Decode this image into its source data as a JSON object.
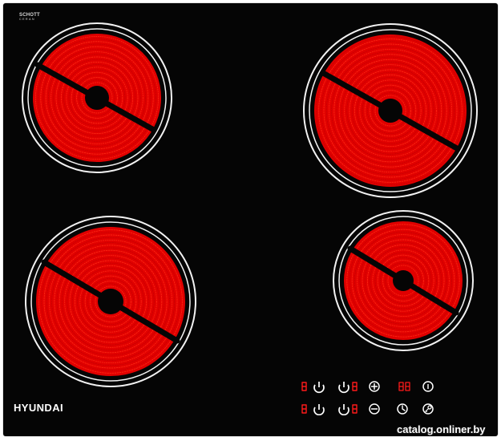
{
  "brand": {
    "name": "HYUNDAI"
  },
  "glass_logo": {
    "main": "SCHOTT",
    "sub": "CERAN"
  },
  "watermark": {
    "text": "catalog.onliner.by"
  },
  "colors": {
    "glass": "#050505",
    "coil": "#e00000",
    "coil_highlight": "#ff2a14",
    "ring": "#f2f2f2",
    "control_red": "#ff1a1a",
    "control_white": "#ffffff"
  },
  "cooking_zones": [
    {
      "name": "rear-left-zone"
    },
    {
      "name": "rear-right-zone"
    },
    {
      "name": "front-left-zone"
    },
    {
      "name": "front-right-zone"
    }
  ],
  "controls": [
    {
      "name": "rear-left-power-button",
      "icon": "power-icon"
    },
    {
      "name": "rear-right-power-button",
      "icon": "power-icon"
    },
    {
      "name": "increase-button",
      "icon": "plus-icon"
    },
    {
      "name": "timer-display",
      "icon": "digit-pair"
    },
    {
      "name": "info-button",
      "icon": "info-icon"
    },
    {
      "name": "front-left-power-button",
      "icon": "power-icon"
    },
    {
      "name": "front-right-power-button",
      "icon": "power-icon"
    },
    {
      "name": "decrease-button",
      "icon": "minus-icon"
    },
    {
      "name": "timer-button",
      "icon": "clock-icon"
    },
    {
      "name": "lock-button",
      "icon": "key-icon"
    }
  ]
}
